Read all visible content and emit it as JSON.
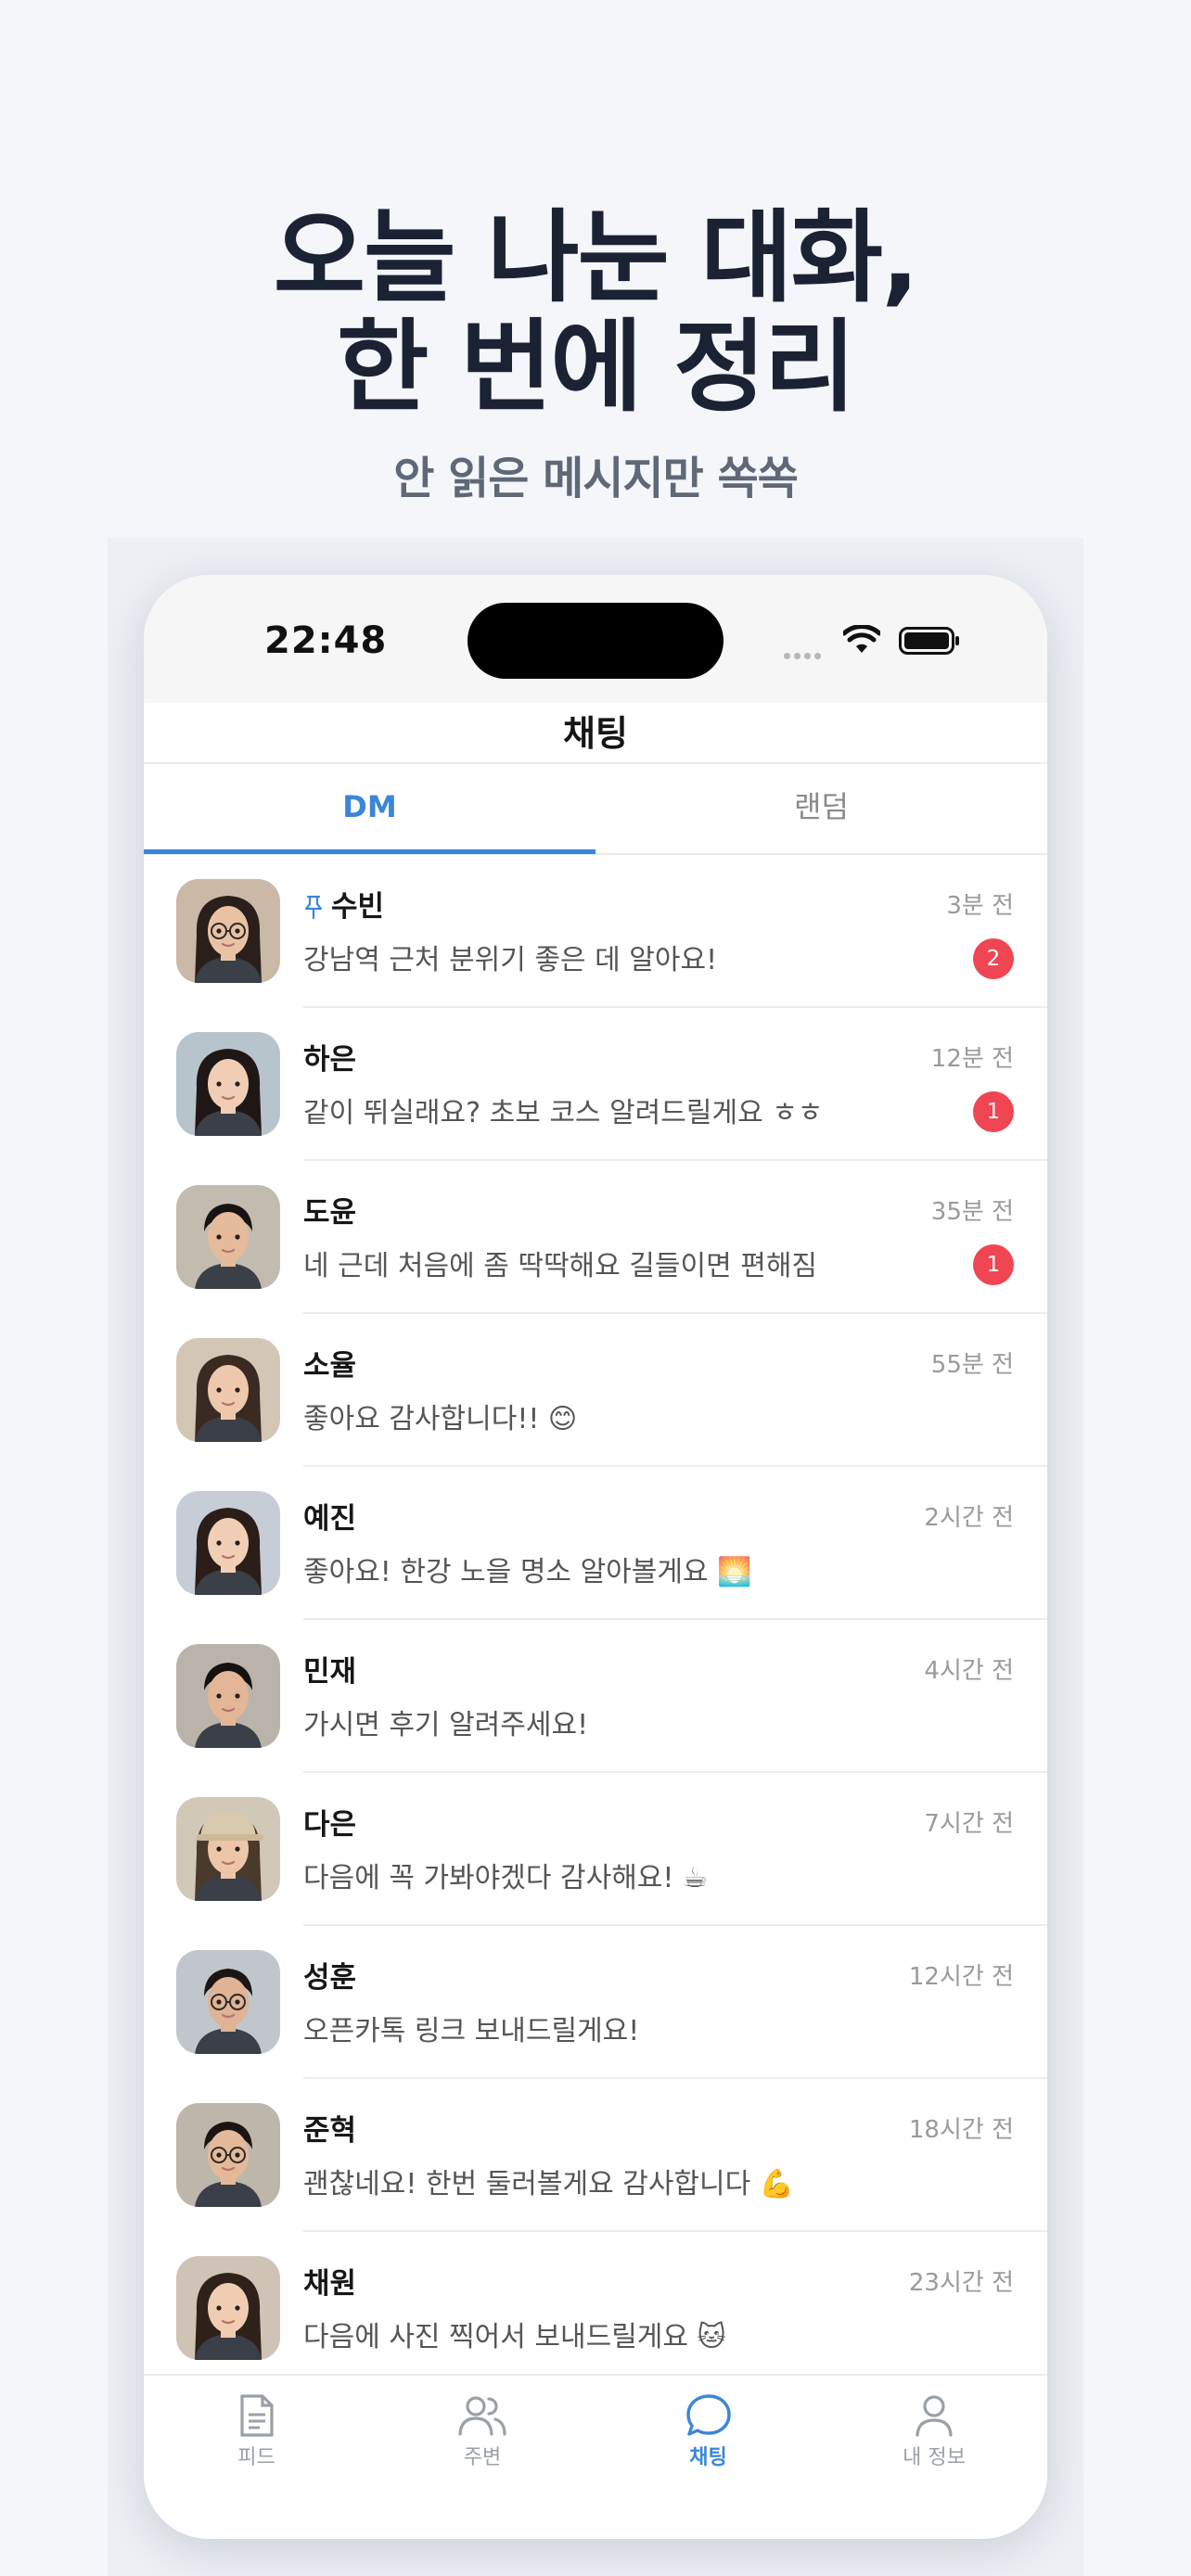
{
  "hero": {
    "headline_line1": "오늘 나눈 대화,",
    "headline_line2": "한 번에 정리",
    "subline": "안 읽은 메시지만 쏙쏙"
  },
  "status_bar": {
    "time": "22:48"
  },
  "header": {
    "title": "채팅"
  },
  "tabs": [
    {
      "label": "DM",
      "active": true
    },
    {
      "label": "랜덤",
      "active": false
    }
  ],
  "chats": [
    {
      "name": "수빈",
      "pinned": true,
      "time": "3분 전",
      "preview": "강남역 근처 분위기 좋은 데 알아요!",
      "unread": "2"
    },
    {
      "name": "하은",
      "pinned": false,
      "time": "12분 전",
      "preview": "같이 뛰실래요? 초보 코스 알려드릴게요 ㅎㅎ",
      "unread": "1"
    },
    {
      "name": "도윤",
      "pinned": false,
      "time": "35분 전",
      "preview": "네 근데 처음에 좀 딱딱해요 길들이면 편해짐",
      "unread": "1"
    },
    {
      "name": "소율",
      "pinned": false,
      "time": "55분 전",
      "preview": "좋아요 감사합니다!! 😊",
      "unread": ""
    },
    {
      "name": "예진",
      "pinned": false,
      "time": "2시간 전",
      "preview": "좋아요! 한강 노을 명소 알아볼게요 🌅",
      "unread": ""
    },
    {
      "name": "민재",
      "pinned": false,
      "time": "4시간 전",
      "preview": "가시면 후기 알려주세요!",
      "unread": ""
    },
    {
      "name": "다은",
      "pinned": false,
      "time": "7시간 전",
      "preview": "다음에 꼭 가봐야겠다 감사해요! ☕",
      "unread": ""
    },
    {
      "name": "성훈",
      "pinned": false,
      "time": "12시간 전",
      "preview": "오픈카톡 링크 보내드릴게요!",
      "unread": ""
    },
    {
      "name": "준혁",
      "pinned": false,
      "time": "18시간 전",
      "preview": "괜찮네요! 한번 둘러볼게요 감사합니다 💪",
      "unread": ""
    },
    {
      "name": "채원",
      "pinned": false,
      "time": "23시간 전",
      "preview": "다음에 사진 찍어서 보내드릴게요 🐱",
      "unread": ""
    }
  ],
  "bottom_tabs": [
    {
      "label": "피드",
      "icon": "document-icon",
      "active": false
    },
    {
      "label": "주변",
      "icon": "people-icon",
      "active": false
    },
    {
      "label": "채팅",
      "icon": "chat-bubble-icon",
      "active": true
    },
    {
      "label": "내 정보",
      "icon": "person-icon",
      "active": false
    }
  ],
  "colors": {
    "accent": "#3a86d8",
    "badge": "#f04552",
    "headline": "#1b2233"
  }
}
